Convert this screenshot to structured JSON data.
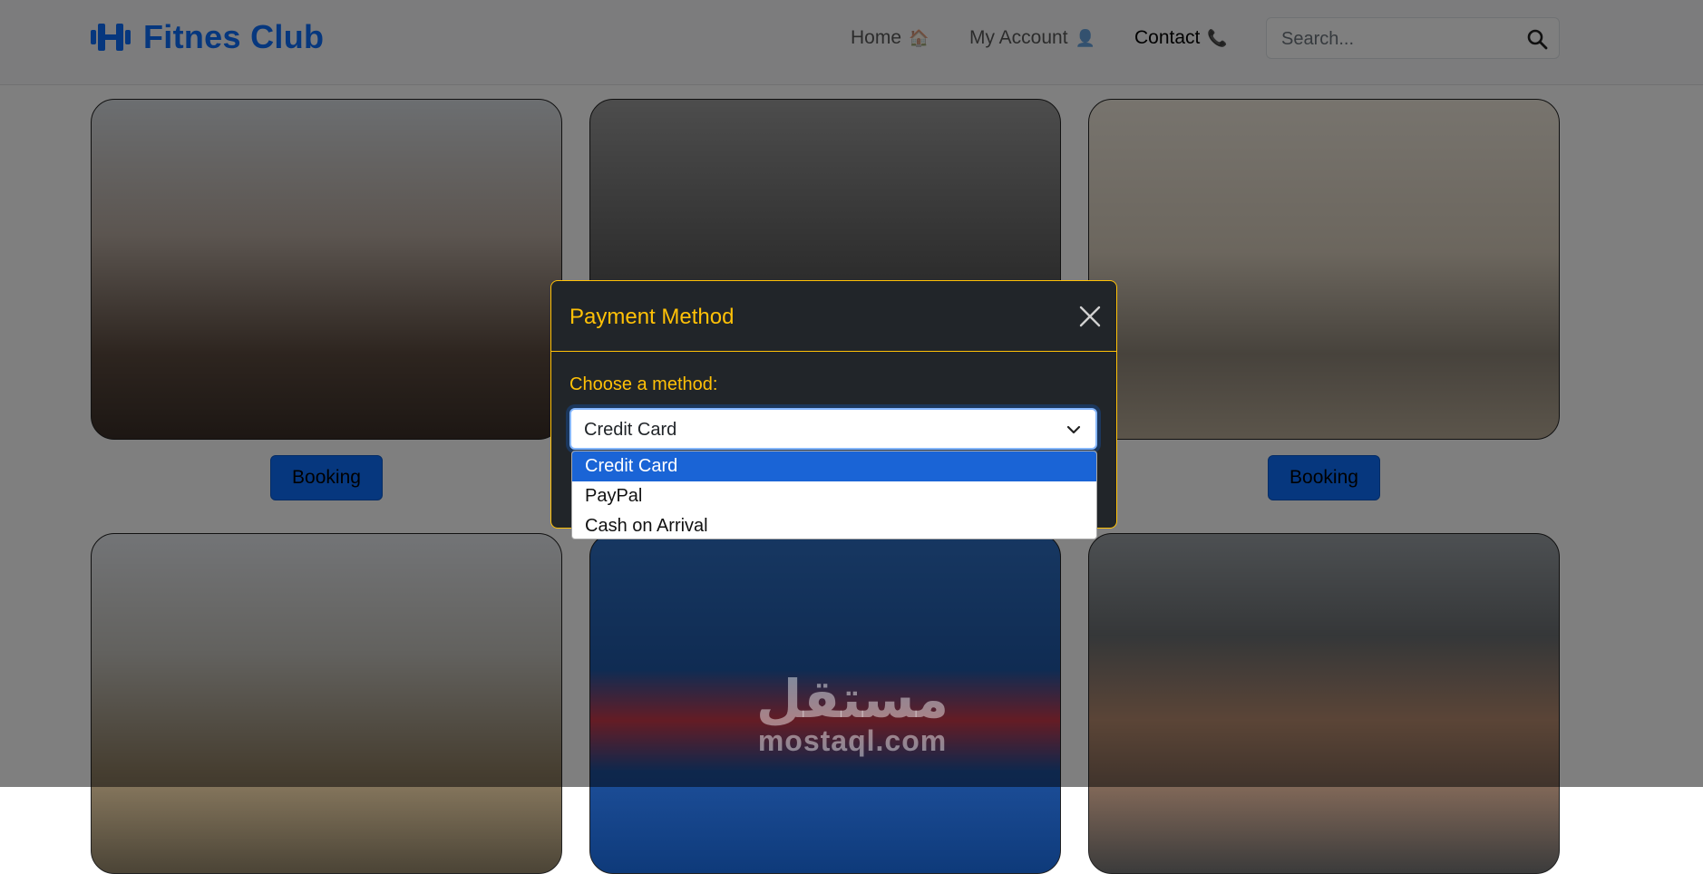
{
  "navbar": {
    "brand": "Fitnes Club",
    "links": [
      {
        "label": "Home",
        "emoji": "🏠"
      },
      {
        "label": "My Account",
        "emoji": "👤"
      },
      {
        "label": "Contact",
        "emoji": "📞"
      }
    ],
    "search_placeholder": "Search..."
  },
  "cards": {
    "booking_label": "Booking"
  },
  "modal": {
    "title": "Payment Method",
    "method_label": "Choose a method:",
    "selected_value": "Credit Card",
    "options": [
      "Credit Card",
      "PayPal",
      "Cash on Arrival"
    ]
  },
  "watermark": {
    "arabic": "مستقل",
    "latin": "mostaql.com"
  },
  "colors": {
    "accent": "#ffc107",
    "primary": "#0d6efd",
    "modal_bg": "#212529"
  }
}
